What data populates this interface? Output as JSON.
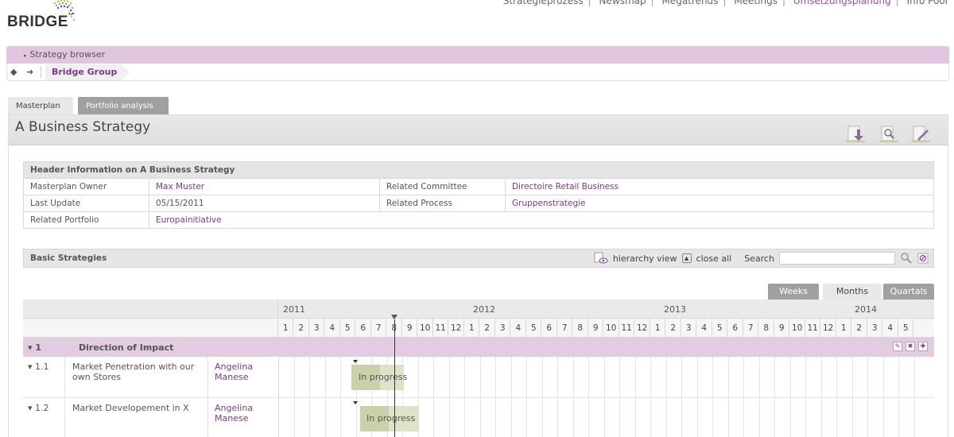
{
  "app": {
    "logo_text": "BRIDGE",
    "logo_tm": "™",
    "top_nav": [
      "Strategieprozess",
      "Newsmap",
      "Megatrends",
      "Meetings",
      "Umsetzungsplanung",
      "Info Pool"
    ],
    "top_nav_active": "Umsetzungsplanung"
  },
  "browser": {
    "title": "Strategy browser",
    "crumb": "Bridge Group"
  },
  "tabs": [
    {
      "label": "Masterplan",
      "active": true
    },
    {
      "label": "Portfolio analysis",
      "active": false
    }
  ],
  "page": {
    "title": "A Business Strategy"
  },
  "header_info": {
    "caption": "Header Information on A Business Strategy",
    "rows": [
      {
        "label": "Masterplan Owner",
        "value": "Max Muster",
        "label2": "Related Committee",
        "value2": "Directoire Retail Business"
      },
      {
        "label": "Last Update",
        "value": "05/15/2011",
        "label2": "Related Process",
        "value2": "Gruppenstrategie"
      },
      {
        "label": "Related Portfolio",
        "value": "Europainitiative",
        "label2": "",
        "value2": ""
      }
    ]
  },
  "basic": {
    "title": "Basic Strategies",
    "hierarchy_view": "hierarchy view",
    "close_all": "close all",
    "search_label": "Search",
    "search_value": ""
  },
  "view_toggle": {
    "weeks": "Weeks",
    "months": "Months",
    "quartals": "Quartals",
    "active": "Months"
  },
  "gantt": {
    "years": [
      "2011",
      "2012",
      "2013",
      "2014"
    ],
    "months": [
      "1",
      "2",
      "3",
      "4",
      "5",
      "6",
      "7",
      "8",
      "9",
      "10",
      "11",
      "12",
      "1",
      "2",
      "3",
      "4",
      "5",
      "6",
      "7",
      "8",
      "9",
      "10",
      "11",
      "12",
      "1",
      "2",
      "3",
      "4",
      "5",
      "6",
      "7",
      "8",
      "9",
      "10",
      "11",
      "12",
      "1",
      "2",
      "3",
      "4",
      "5"
    ],
    "group": {
      "num": "1",
      "name": "Direction of Impact"
    },
    "items": [
      {
        "num": "1.1",
        "name": "Market Penetration with our own Stores",
        "owner": "Angelina Manese",
        "status": "In progress"
      },
      {
        "num": "1.2",
        "name": "Market Developement in X",
        "owner": "Angelina Manese",
        "status": "In progress"
      }
    ]
  },
  "colors": {
    "accent": "#7a3b86",
    "bar_purple": "#e0c6df",
    "progress_bar": "#c6cfa6"
  }
}
